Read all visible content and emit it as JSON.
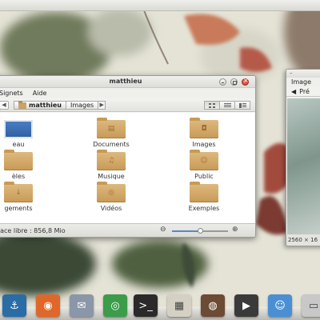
{
  "file_manager": {
    "title": "matthieu",
    "menu": [
      "Signets",
      "Aide"
    ],
    "breadcrumb": [
      "matthieu",
      "Images"
    ],
    "items": [
      {
        "label": "eau",
        "icon": "desktop-folder-icon"
      },
      {
        "label": "Documents",
        "icon": "documents-folder-icon"
      },
      {
        "label": "Images",
        "icon": "pictures-folder-icon"
      },
      {
        "label": "èles",
        "icon": "templates-folder-icon"
      },
      {
        "label": "Musique",
        "icon": "music-folder-icon"
      },
      {
        "label": "Public",
        "icon": "public-folder-icon"
      },
      {
        "label": "gements",
        "icon": "downloads-folder-icon"
      },
      {
        "label": "Vidéos",
        "icon": "videos-folder-icon"
      },
      {
        "label": "Exemples",
        "icon": "examples-folder-icon"
      }
    ],
    "status": "pace libre : 856,8 Mio",
    "zoom_level": 0.5
  },
  "image_viewer": {
    "title": "–",
    "menu_label": "Image",
    "toolbar_label": "Pré",
    "status": "2560 × 16"
  },
  "dock": [
    {
      "name": "anchor-app-icon",
      "color": "#2a6ca6",
      "glyph": "⚓"
    },
    {
      "name": "firefox-icon",
      "color": "#e0672a",
      "glyph": "◉"
    },
    {
      "name": "mail-icon",
      "color": "#8a97a8",
      "glyph": "✉"
    },
    {
      "name": "chrome-icon",
      "color": "#3b9c4a",
      "glyph": "◎"
    },
    {
      "name": "terminal-icon",
      "color": "#2a2a2a",
      "glyph": ">_"
    },
    {
      "name": "calculator-icon",
      "color": "#d4d0c4",
      "glyph": "▦"
    },
    {
      "name": "speaker-icon",
      "color": "#6c4a33",
      "glyph": "◍"
    },
    {
      "name": "video-player-icon",
      "color": "#3a3a3a",
      "glyph": "▶"
    },
    {
      "name": "chat-icon",
      "color": "#4a8fd4",
      "glyph": "☺"
    },
    {
      "name": "drive-icon",
      "color": "#c8c8c8",
      "glyph": "▭"
    }
  ]
}
